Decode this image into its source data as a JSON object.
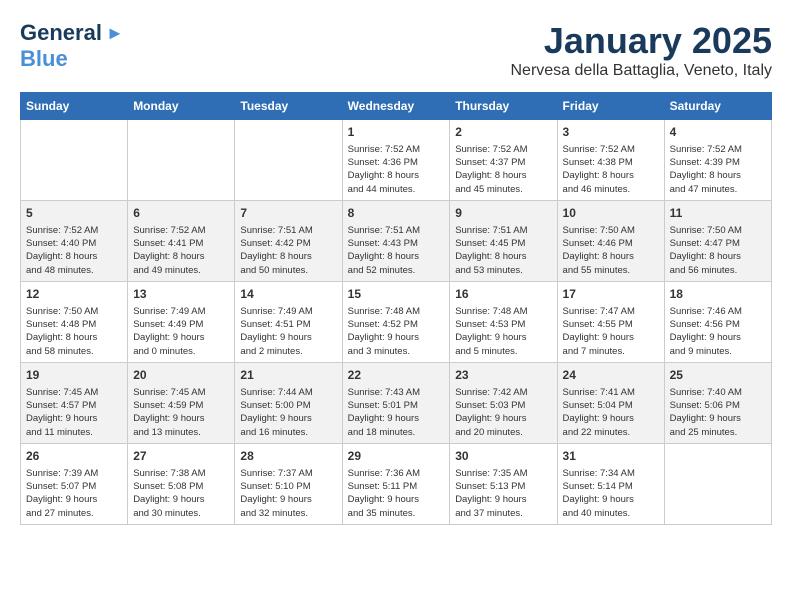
{
  "header": {
    "logo_line1": "General",
    "logo_line2": "Blue",
    "month": "January 2025",
    "location": "Nervesa della Battaglia, Veneto, Italy"
  },
  "weekdays": [
    "Sunday",
    "Monday",
    "Tuesday",
    "Wednesday",
    "Thursday",
    "Friday",
    "Saturday"
  ],
  "weeks": [
    [
      {
        "day": "",
        "info": ""
      },
      {
        "day": "",
        "info": ""
      },
      {
        "day": "",
        "info": ""
      },
      {
        "day": "1",
        "info": "Sunrise: 7:52 AM\nSunset: 4:36 PM\nDaylight: 8 hours\nand 44 minutes."
      },
      {
        "day": "2",
        "info": "Sunrise: 7:52 AM\nSunset: 4:37 PM\nDaylight: 8 hours\nand 45 minutes."
      },
      {
        "day": "3",
        "info": "Sunrise: 7:52 AM\nSunset: 4:38 PM\nDaylight: 8 hours\nand 46 minutes."
      },
      {
        "day": "4",
        "info": "Sunrise: 7:52 AM\nSunset: 4:39 PM\nDaylight: 8 hours\nand 47 minutes."
      }
    ],
    [
      {
        "day": "5",
        "info": "Sunrise: 7:52 AM\nSunset: 4:40 PM\nDaylight: 8 hours\nand 48 minutes."
      },
      {
        "day": "6",
        "info": "Sunrise: 7:52 AM\nSunset: 4:41 PM\nDaylight: 8 hours\nand 49 minutes."
      },
      {
        "day": "7",
        "info": "Sunrise: 7:51 AM\nSunset: 4:42 PM\nDaylight: 8 hours\nand 50 minutes."
      },
      {
        "day": "8",
        "info": "Sunrise: 7:51 AM\nSunset: 4:43 PM\nDaylight: 8 hours\nand 52 minutes."
      },
      {
        "day": "9",
        "info": "Sunrise: 7:51 AM\nSunset: 4:45 PM\nDaylight: 8 hours\nand 53 minutes."
      },
      {
        "day": "10",
        "info": "Sunrise: 7:50 AM\nSunset: 4:46 PM\nDaylight: 8 hours\nand 55 minutes."
      },
      {
        "day": "11",
        "info": "Sunrise: 7:50 AM\nSunset: 4:47 PM\nDaylight: 8 hours\nand 56 minutes."
      }
    ],
    [
      {
        "day": "12",
        "info": "Sunrise: 7:50 AM\nSunset: 4:48 PM\nDaylight: 8 hours\nand 58 minutes."
      },
      {
        "day": "13",
        "info": "Sunrise: 7:49 AM\nSunset: 4:49 PM\nDaylight: 9 hours\nand 0 minutes."
      },
      {
        "day": "14",
        "info": "Sunrise: 7:49 AM\nSunset: 4:51 PM\nDaylight: 9 hours\nand 2 minutes."
      },
      {
        "day": "15",
        "info": "Sunrise: 7:48 AM\nSunset: 4:52 PM\nDaylight: 9 hours\nand 3 minutes."
      },
      {
        "day": "16",
        "info": "Sunrise: 7:48 AM\nSunset: 4:53 PM\nDaylight: 9 hours\nand 5 minutes."
      },
      {
        "day": "17",
        "info": "Sunrise: 7:47 AM\nSunset: 4:55 PM\nDaylight: 9 hours\nand 7 minutes."
      },
      {
        "day": "18",
        "info": "Sunrise: 7:46 AM\nSunset: 4:56 PM\nDaylight: 9 hours\nand 9 minutes."
      }
    ],
    [
      {
        "day": "19",
        "info": "Sunrise: 7:45 AM\nSunset: 4:57 PM\nDaylight: 9 hours\nand 11 minutes."
      },
      {
        "day": "20",
        "info": "Sunrise: 7:45 AM\nSunset: 4:59 PM\nDaylight: 9 hours\nand 13 minutes."
      },
      {
        "day": "21",
        "info": "Sunrise: 7:44 AM\nSunset: 5:00 PM\nDaylight: 9 hours\nand 16 minutes."
      },
      {
        "day": "22",
        "info": "Sunrise: 7:43 AM\nSunset: 5:01 PM\nDaylight: 9 hours\nand 18 minutes."
      },
      {
        "day": "23",
        "info": "Sunrise: 7:42 AM\nSunset: 5:03 PM\nDaylight: 9 hours\nand 20 minutes."
      },
      {
        "day": "24",
        "info": "Sunrise: 7:41 AM\nSunset: 5:04 PM\nDaylight: 9 hours\nand 22 minutes."
      },
      {
        "day": "25",
        "info": "Sunrise: 7:40 AM\nSunset: 5:06 PM\nDaylight: 9 hours\nand 25 minutes."
      }
    ],
    [
      {
        "day": "26",
        "info": "Sunrise: 7:39 AM\nSunset: 5:07 PM\nDaylight: 9 hours\nand 27 minutes."
      },
      {
        "day": "27",
        "info": "Sunrise: 7:38 AM\nSunset: 5:08 PM\nDaylight: 9 hours\nand 30 minutes."
      },
      {
        "day": "28",
        "info": "Sunrise: 7:37 AM\nSunset: 5:10 PM\nDaylight: 9 hours\nand 32 minutes."
      },
      {
        "day": "29",
        "info": "Sunrise: 7:36 AM\nSunset: 5:11 PM\nDaylight: 9 hours\nand 35 minutes."
      },
      {
        "day": "30",
        "info": "Sunrise: 7:35 AM\nSunset: 5:13 PM\nDaylight: 9 hours\nand 37 minutes."
      },
      {
        "day": "31",
        "info": "Sunrise: 7:34 AM\nSunset: 5:14 PM\nDaylight: 9 hours\nand 40 minutes."
      },
      {
        "day": "",
        "info": ""
      }
    ]
  ]
}
